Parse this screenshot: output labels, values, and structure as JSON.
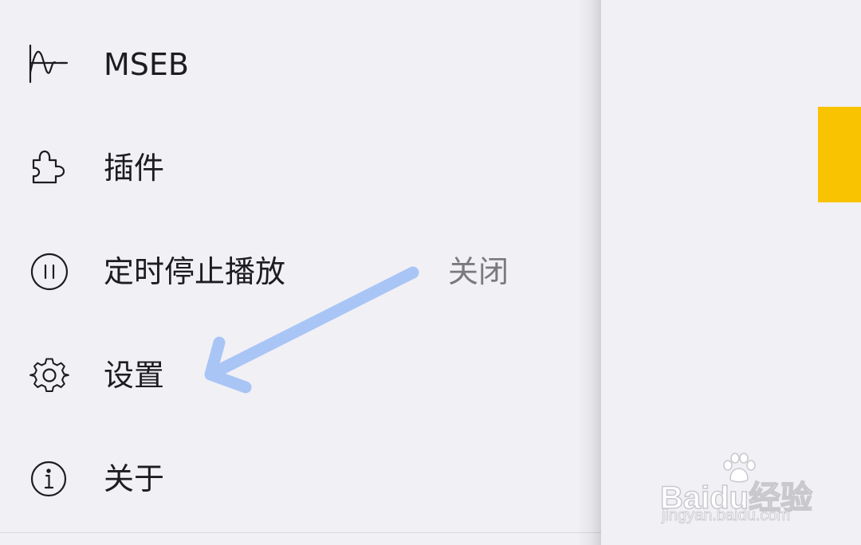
{
  "drawer": {
    "items": [
      {
        "label": "MSEB",
        "icon": "waveform-icon"
      },
      {
        "label": "插件",
        "icon": "puzzle-icon"
      },
      {
        "label": "定时停止播放",
        "icon": "timer-stop-icon",
        "value": "关闭"
      },
      {
        "label": "设置",
        "icon": "gear-icon"
      },
      {
        "label": "关于",
        "icon": "info-icon"
      }
    ]
  },
  "watermark": {
    "brand": "Bai",
    "brand_tail": "du",
    "product": "经验",
    "url": "jingyan.baidu.com"
  },
  "colors": {
    "background": "#f1f0f5",
    "text": "#1d1c21",
    "secondary_text": "#7a797e",
    "accent_yellow": "#f9c301",
    "arrow": "#a9c5f6"
  }
}
